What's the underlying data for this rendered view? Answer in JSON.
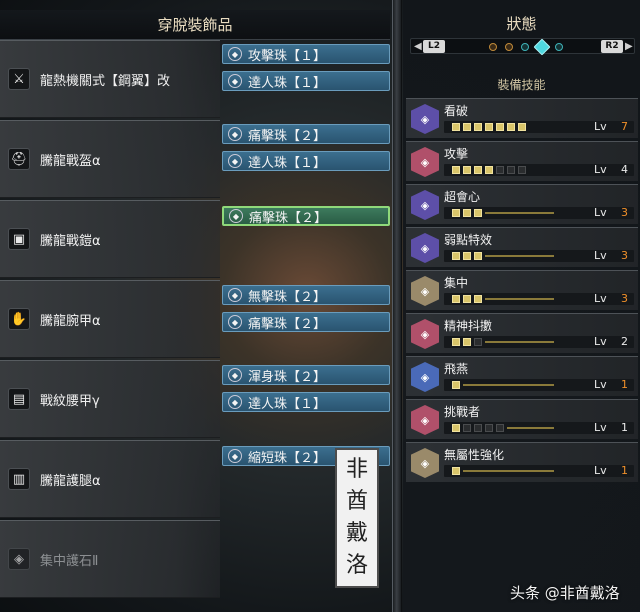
{
  "left_panel": {
    "title": "穿脫裝飾品",
    "equipment": [
      {
        "name": "龍熱機關式【鋼翼】改",
        "icon": "weapon-icon",
        "glyph": "⚔",
        "decorations": [
          "攻擊珠【１】",
          "達人珠【１】"
        ]
      },
      {
        "name": "騰龍戰盔α",
        "icon": "helm-icon",
        "glyph": "⛑",
        "decorations": [
          "痛擊珠【２】",
          "達人珠【１】"
        ]
      },
      {
        "name": "騰龍戰鎧α",
        "icon": "chest-armor-icon",
        "glyph": "▣",
        "decorations": [
          "痛擊珠【２】"
        ]
      },
      {
        "name": "騰龍腕甲α",
        "icon": "gauntlet-icon",
        "glyph": "✋",
        "decorations": [
          "無擊珠【２】",
          "痛擊珠【２】"
        ]
      },
      {
        "name": "戰紋腰甲γ",
        "icon": "waist-armor-icon",
        "glyph": "▤",
        "decorations": [
          "渾身珠【２】",
          "達人珠【１】"
        ]
      },
      {
        "name": "騰龍護腿α",
        "icon": "leg-armor-icon",
        "glyph": "▥",
        "decorations": [
          "縮短珠【２】"
        ]
      },
      {
        "name": "集中護石Ⅱ",
        "icon": "charm-icon",
        "glyph": "◈",
        "decorations": []
      }
    ]
  },
  "right_panel": {
    "title": "狀態",
    "tabs": {
      "left_key": "L2",
      "right_key": "R2"
    },
    "skills_title": "裝備技能",
    "lv_label": "Lv",
    "skills": [
      {
        "name": "看破",
        "level": "7",
        "max": 7,
        "icon_color": "#5d4fa8",
        "num_color": "#f0902a"
      },
      {
        "name": "攻擊",
        "level": "4",
        "max": 7,
        "icon_color": "#b0506a",
        "num_color": "#eaeaea"
      },
      {
        "name": "超會心",
        "level": "3",
        "max": 3,
        "icon_color": "#5d4fa8",
        "num_color": "#f0902a"
      },
      {
        "name": "弱點特效",
        "level": "3",
        "max": 3,
        "icon_color": "#5d4fa8",
        "num_color": "#f0902a"
      },
      {
        "name": "集中",
        "level": "3",
        "max": 3,
        "icon_color": "#9a8a6a",
        "num_color": "#f0902a"
      },
      {
        "name": "精神抖擻",
        "level": "2",
        "max": 3,
        "icon_color": "#b0506a",
        "num_color": "#eaeaea"
      },
      {
        "name": "飛燕",
        "level": "1",
        "max": 1,
        "icon_color": "#4a6ab8",
        "num_color": "#f0902a"
      },
      {
        "name": "挑戰者",
        "level": "1",
        "max": 5,
        "icon_color": "#b0506a",
        "num_color": "#eaeaea"
      },
      {
        "name": "無屬性強化",
        "level": "1",
        "max": 1,
        "icon_color": "#9a8a6a",
        "num_color": "#f0902a"
      }
    ]
  },
  "watermark": {
    "stamp": [
      "非",
      "酋",
      "戴",
      "洛"
    ],
    "credit": "头条 @非酋戴洛"
  }
}
